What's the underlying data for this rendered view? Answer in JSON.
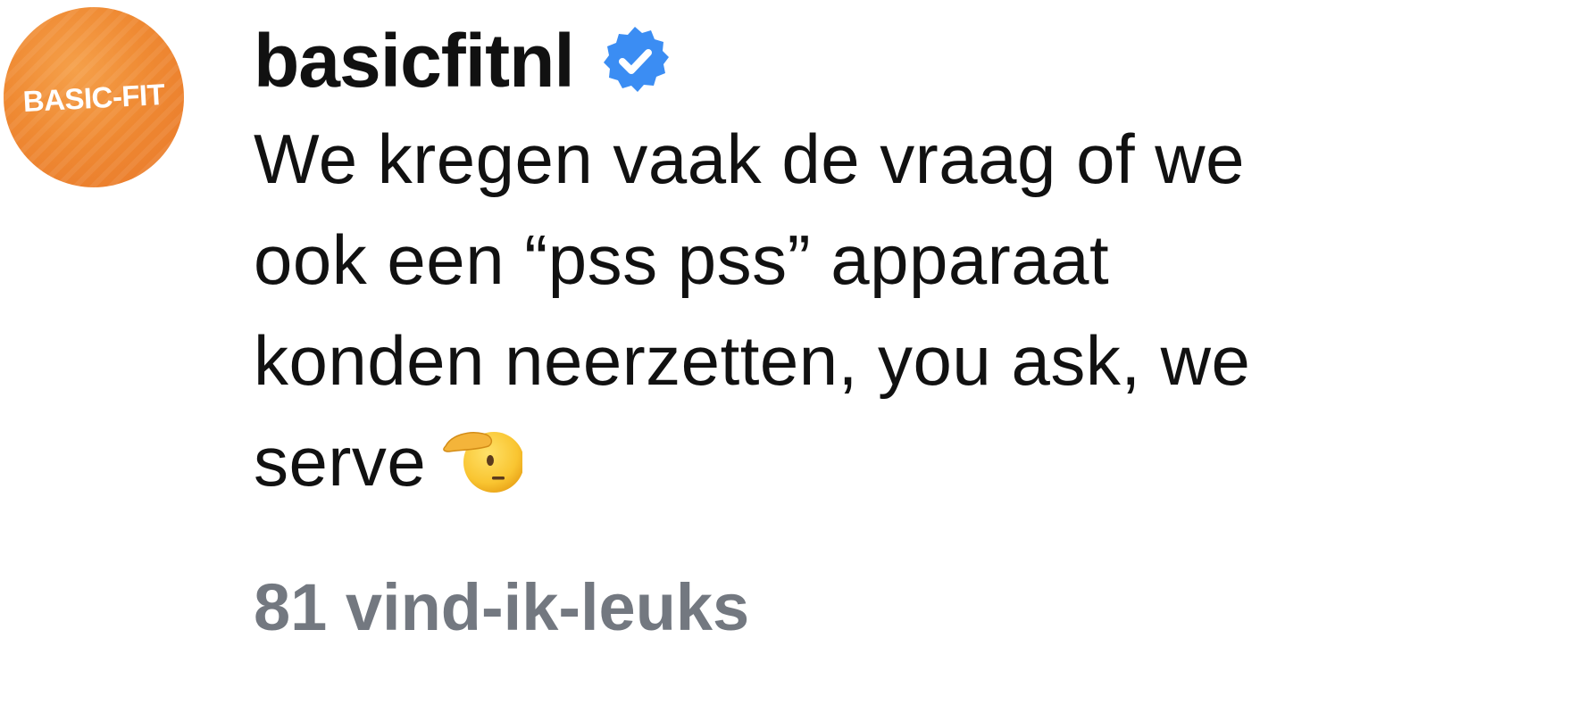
{
  "post": {
    "avatar": {
      "logo_text": "BASIC-FIT",
      "background_color": "#ef8a33"
    },
    "username": "basicfitnl",
    "verified_icon": "verified-badge-icon",
    "verified_color": "#3b8df3",
    "caption_lines": [
      "We kregen vaak de vraag of we",
      "ook een “pss pss” apparaat",
      "konden neerzetten, you ask, we",
      "serve"
    ],
    "caption_emoji": "saluting-face-emoji",
    "likes": "81 vind-ik-leuks"
  }
}
